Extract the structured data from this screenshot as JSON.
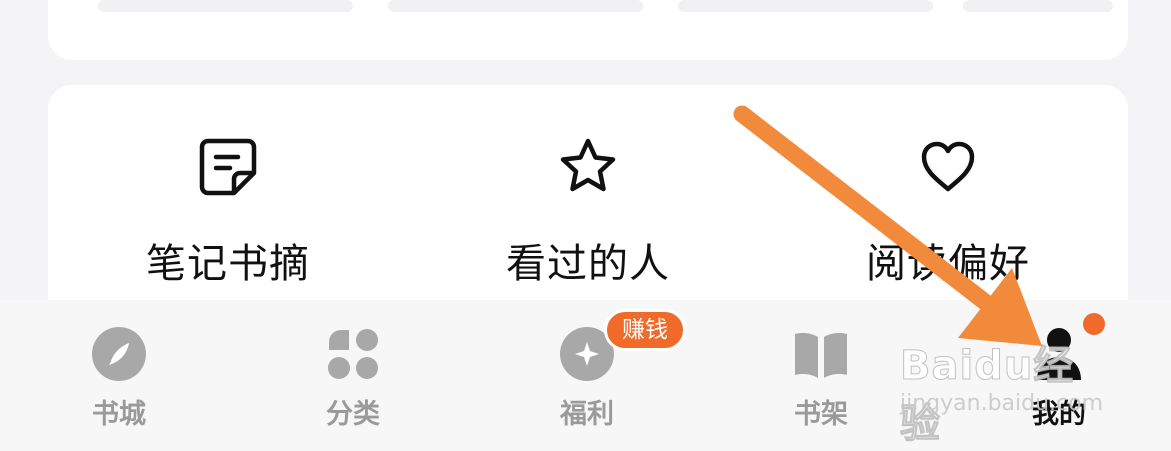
{
  "features": [
    {
      "icon": "note-icon",
      "label": "笔记书摘"
    },
    {
      "icon": "star-icon",
      "label": "看过的人"
    },
    {
      "icon": "heart-icon",
      "label": "阅读偏好"
    }
  ],
  "tabs": [
    {
      "icon": "compass-icon",
      "label": "书城",
      "active": false
    },
    {
      "icon": "category-icon",
      "label": "分类",
      "active": false
    },
    {
      "icon": "gift-icon",
      "label": "福利",
      "active": false
    },
    {
      "icon": "book-icon",
      "label": "书架",
      "active": false
    },
    {
      "icon": "person-icon",
      "label": "我的",
      "active": true
    }
  ],
  "badge": {
    "welfare": "赚钱"
  },
  "watermark": {
    "main": "Baidu经验",
    "sub": "jingyan.baidu.com"
  },
  "colors": {
    "accent": "#f06a2a",
    "arrow": "#f28a3c",
    "inactive": "#9a9a9a",
    "active": "#111111"
  }
}
